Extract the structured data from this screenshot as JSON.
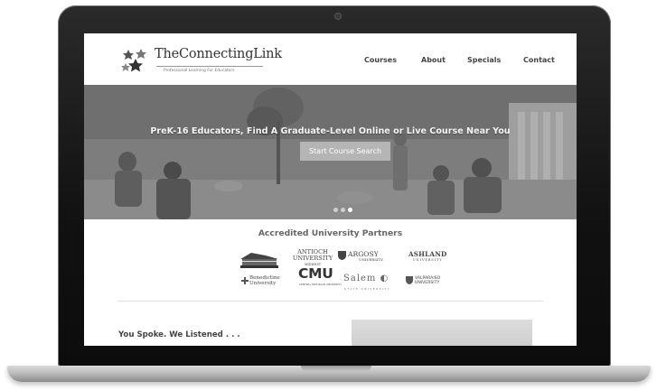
{
  "site": {
    "brand": "TheConnectingLink",
    "tagline": "Professional Learning For Educators"
  },
  "nav": {
    "items": [
      {
        "label": "Courses"
      },
      {
        "label": "About"
      },
      {
        "label": "Specials"
      },
      {
        "label": "Contact"
      }
    ]
  },
  "hero": {
    "headline": "PreK-16 Educators, Find A Graduate-Level Online or Live Course Near You",
    "button_label": "Start Course Search",
    "slides_total": 3,
    "active_slide": 3
  },
  "partners": {
    "heading": "Accredited University Partners",
    "logos": {
      "antioch_line1": "ANTIOCH",
      "antioch_line2": "UNIVERSITY",
      "antioch_sub": "MIDWEST",
      "argosy": "ARGOSY",
      "argosy_sub": "UNIVERSITY.",
      "ashland": "ASHLAND",
      "ashland_sub": "UNIVERSITY",
      "benedictine_line1": "Benedictine",
      "benedictine_line2": "University",
      "cmu": "CMU",
      "cmu_sub": "CENTRAL MICHIGAN UNIVERSITY",
      "salem": "Salem",
      "salem_sub": "STATE UNIVERSITY",
      "valparaiso_line1": "VALPARAISO",
      "valparaiso_line2": "UNIVERSITY"
    }
  },
  "section": {
    "heading": "You Spoke. We Listened . . ."
  },
  "colors": {
    "screen_bg": "#ffffff",
    "hero_bg": "#8f8f8f",
    "laptop_frame": "#111111",
    "text_dark": "#444444"
  },
  "icons": {
    "logo": "star-cluster-icon",
    "camera": "webcam-icon"
  }
}
